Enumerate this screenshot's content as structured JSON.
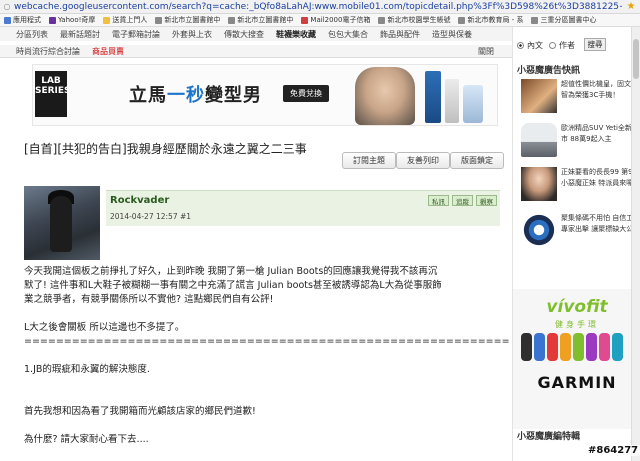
{
  "browser": {
    "url": "webcache.googleusercontent.com/search?q=cache:_bQfo8aLahAJ:www.mobile01.com/topicdetail.php%3Ff%3D598%26t%3D3881225+&",
    "bookmarks": [
      "應用程式",
      "Yahoo!奇摩",
      "送貨上門人",
      "新北市立圖書館中",
      "新北市立圖書館中",
      "Mail2000電子信箱",
      "新北市校園學生帳號",
      "新北市教育局 - 系",
      "三重分區圖書中心"
    ]
  },
  "nav": {
    "row1": [
      "分區列表",
      "最新話題討",
      "電子郵箱討論",
      "外套與上衣",
      "傳散大搜查",
      "鞋襪樂收藏",
      "包包大集合",
      "飾品與配件",
      "造型與保養"
    ],
    "row1_active": "鞋襪樂收藏",
    "row2": [
      "時尚流行綜合討論",
      "商品買賣"
    ],
    "close": "關閉"
  },
  "banner": {
    "logo": "LAB SERIES",
    "slogan_pre": "立馬",
    "slogan_blue": "一秒",
    "slogan_post": "變型男",
    "cta": "免費兌換"
  },
  "thread": {
    "title": "[自首][共犯的告白]我親身經歷關於永遠之翼之二三事",
    "buttons": [
      "訂閱主題",
      "友善列印",
      "版面鎖定"
    ]
  },
  "post": {
    "username": "Rockvader",
    "datetime": "2014-04-27 12:57",
    "floor": "#1",
    "actions": [
      "私訊",
      "追蹤",
      "觀察"
    ],
    "lines": [
      "今天我開這個板之前掙扎了好久，止到昨晚 我開了第一槍 Julian Boots的回應讓我覺得我不該再沉",
      "默了! 這件事和L大鞋子被糊糊一事有關之中充滿了謊言 Julian boots甚至被誘導認為L大為從事服飾",
      "業之競爭者，有競爭關係所以不實他? 這點鄉民們自有公評!",
      "",
      "L大之後會關板 所以這邊也不多提了。",
      "===================================================================",
      "",
      "1.JB的瑕疵和永翼的解決態度.",
      "",
      "",
      "首先我想和因為看了我開箱而光顧該店家的鄉民們道歉!",
      "",
      "為什麼? 請大家耐心看下去...."
    ]
  },
  "sidebar": {
    "search_options": [
      "內文",
      "作者"
    ],
    "search_button": "搜尋",
    "section1": "小惡魔廣告快訊",
    "items": [
      "超值性價比機皇，固文啟智為榮獲3C手機！",
      "歐洲精品SUV Yeti全新上市 88萬9起入主",
      "正妹要看的長長99 第9個小惡魔正妹 特派員來囉～",
      "聚集條碼不用怕 自信工程專家出擊 讓聚標缺大公開"
    ],
    "ad_vivofit": "vívofit",
    "ad_vivofit_sub": "健身手環",
    "ad_garmin": "GARMIN",
    "section2": "小惡魔廣編特輯"
  },
  "watermark": "#864277",
  "colors": {
    "link_blue": "#1a3fa0",
    "username_green": "#2a5a1e",
    "vivofit_green": "#7fbf2e",
    "sale_red": "#cc0000"
  }
}
